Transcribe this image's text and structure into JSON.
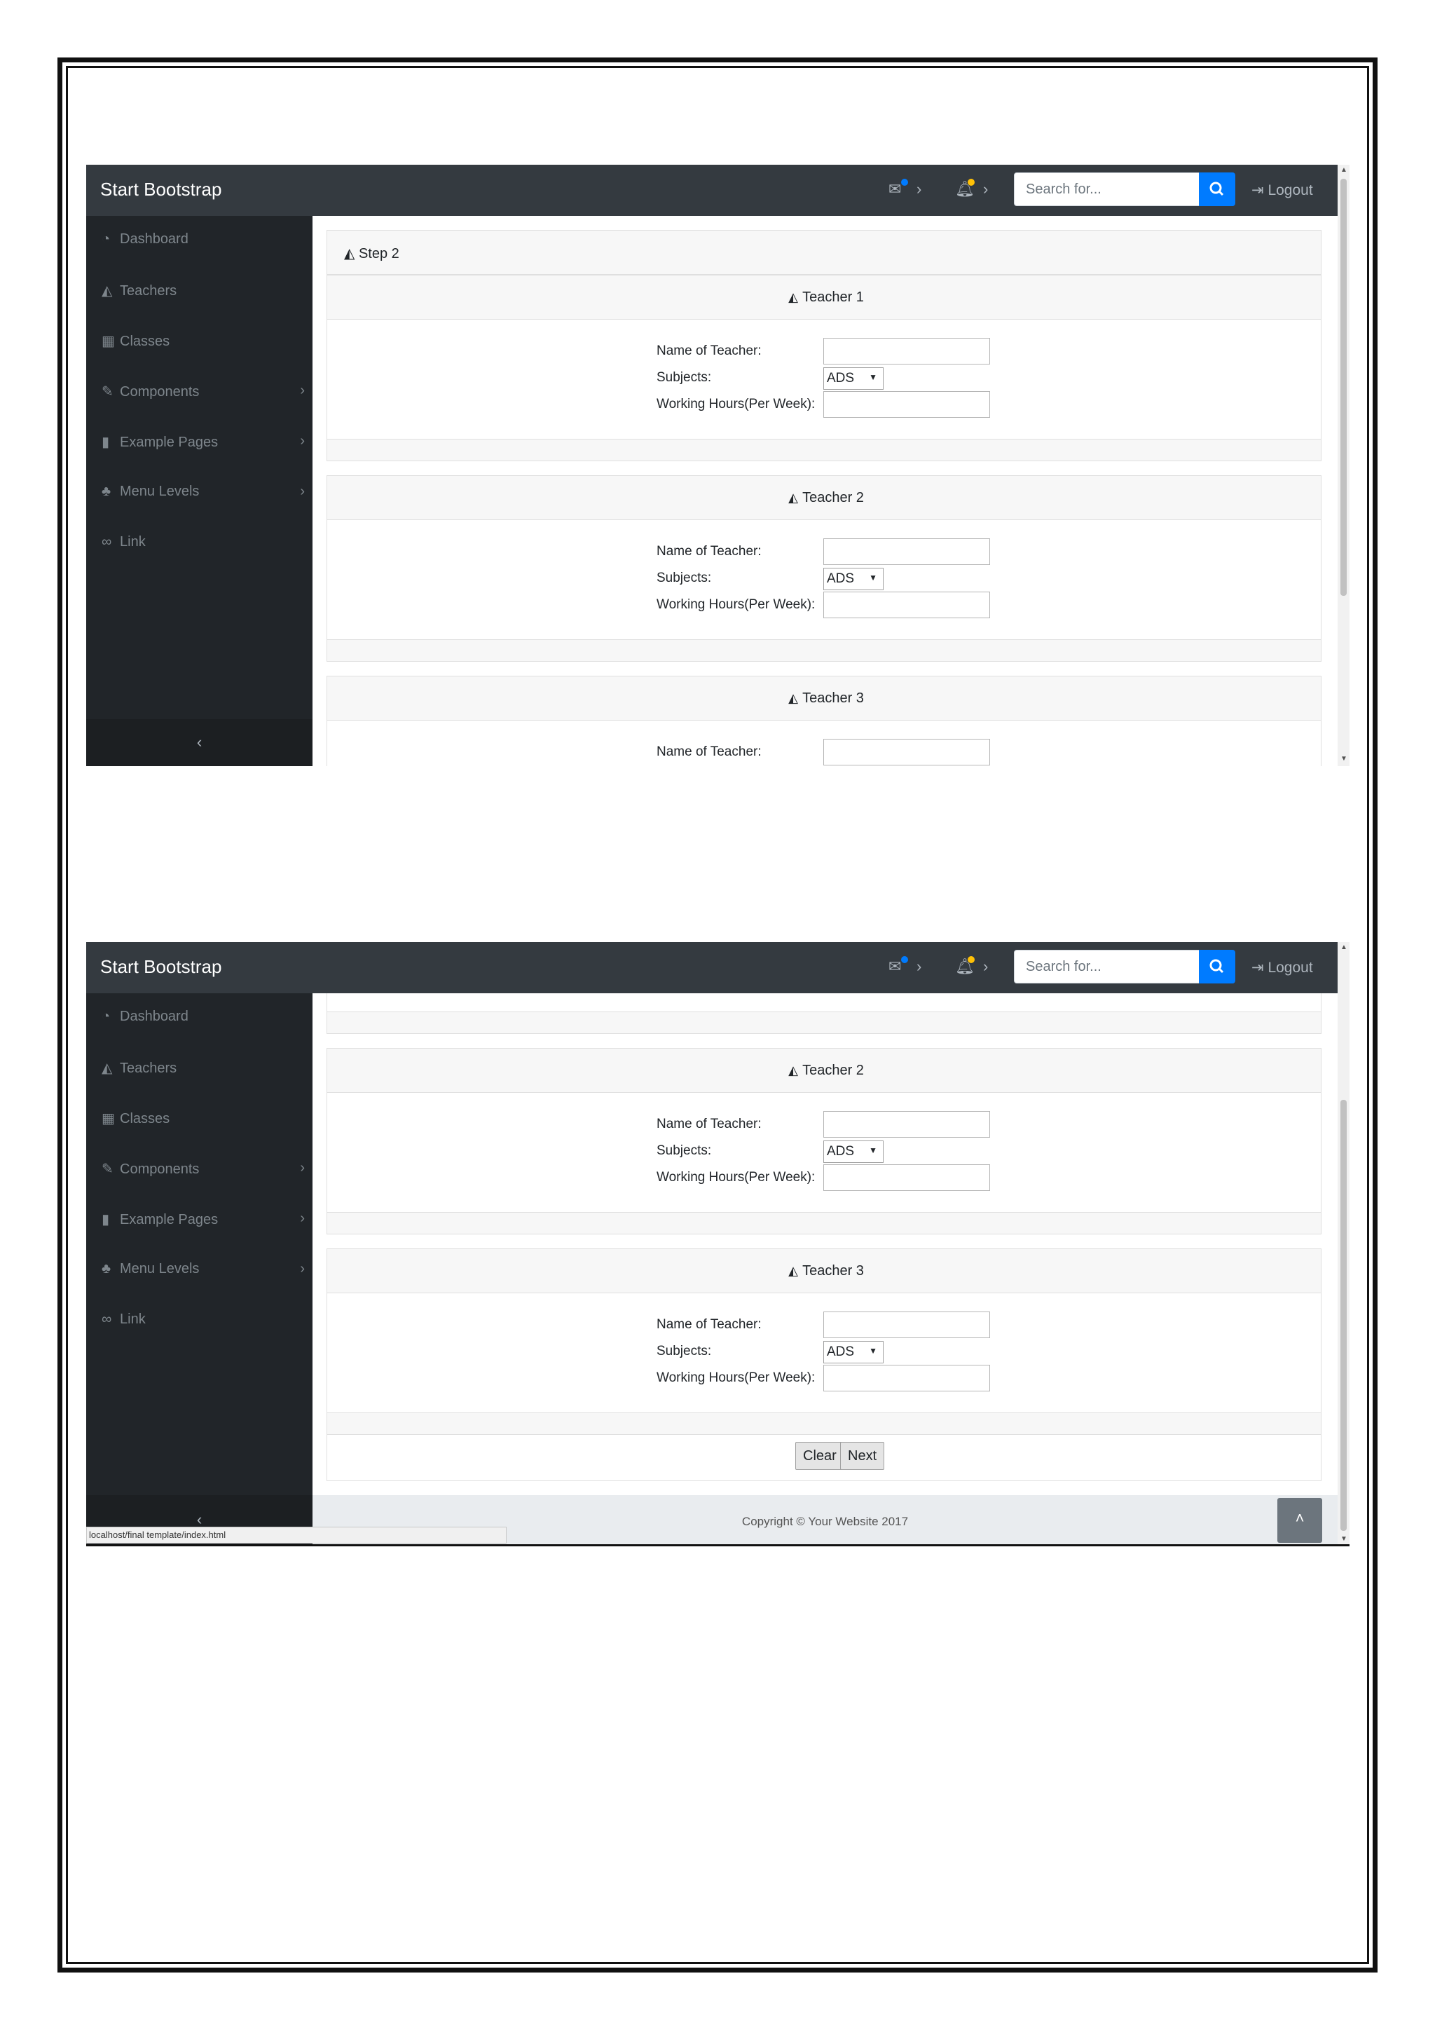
{
  "navbar": {
    "brand": "Start Bootstrap",
    "search_placeholder": "Search for...",
    "logout_label": "Logout",
    "icons": {
      "messages": "envelope-icon",
      "alerts": "bell-icon",
      "search": "search-icon"
    },
    "colors": {
      "navbar_bg": "#343a40",
      "search_button": "#007bff",
      "message_dot": "#007bff",
      "alert_dot": "#ffc107"
    }
  },
  "sidebar": {
    "items": [
      {
        "label": "Dashboard",
        "icon": "dashboard-icon",
        "has_children": false
      },
      {
        "label": "Teachers",
        "icon": "area-chart-icon",
        "has_children": false
      },
      {
        "label": "Classes",
        "icon": "table-icon",
        "has_children": false
      },
      {
        "label": "Components",
        "icon": "wrench-icon",
        "has_children": true
      },
      {
        "label": "Example Pages",
        "icon": "file-icon",
        "has_children": true
      },
      {
        "label": "Menu Levels",
        "icon": "sitemap-icon",
        "has_children": true
      },
      {
        "label": "Link",
        "icon": "link-icon",
        "has_children": false
      }
    ],
    "toggle_label": "‹"
  },
  "form": {
    "step_label": "Step 2",
    "teachers": [
      {
        "title": "Teacher 1"
      },
      {
        "title": "Teacher 2"
      },
      {
        "title": "Teacher 3"
      }
    ],
    "fields": {
      "name_label": "Name of Teacher:",
      "subjects_label": "Subjects:",
      "subjects_value": "ADS",
      "hours_label": "Working Hours(Per Week):"
    },
    "buttons": {
      "clear": "Clear",
      "next": "Next"
    }
  },
  "footer": {
    "copyright": "Copyright © Your Website 2017",
    "scroll_top_label": "˄"
  },
  "status_bar": {
    "url": "localhost/final template/index.html"
  }
}
